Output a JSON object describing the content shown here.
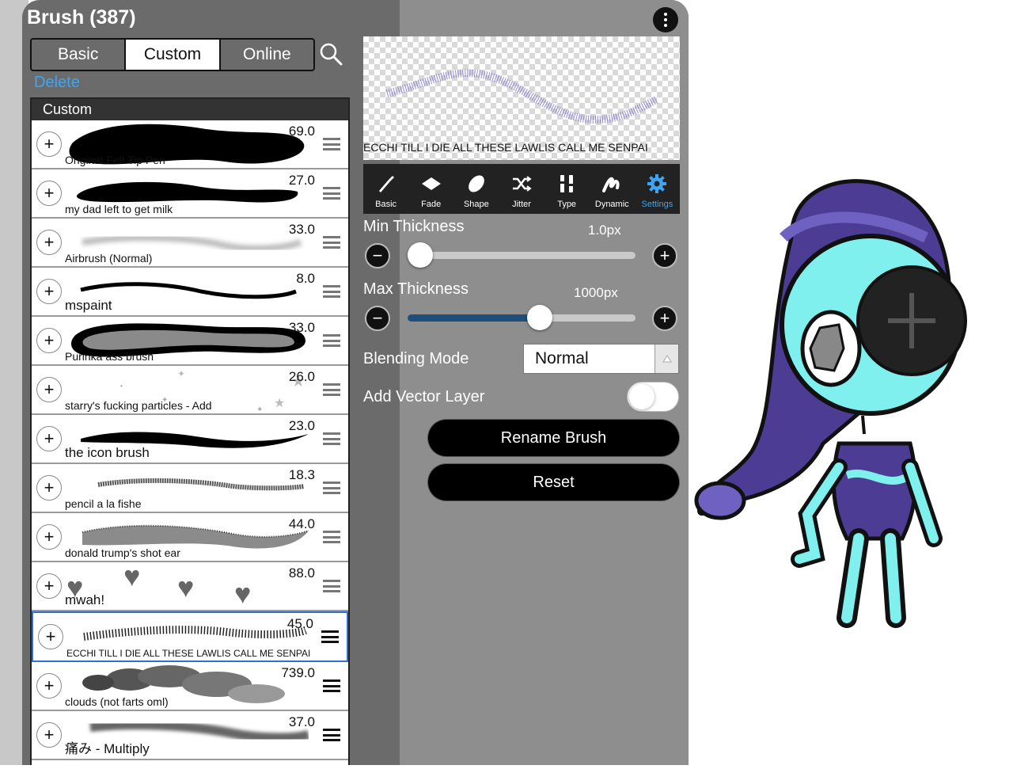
{
  "panel": {
    "title": "Brush (387)",
    "tabs": [
      {
        "label": "Basic"
      },
      {
        "label": "Custom"
      },
      {
        "label": "Online"
      }
    ],
    "delete_label": "Delete",
    "list_header": "Custom"
  },
  "brushes": [
    {
      "name": "Original Felt Tip Pen",
      "value": "69.0"
    },
    {
      "name": "my dad left to get milk",
      "value": "27.0"
    },
    {
      "name": "Airbrush (Normal)",
      "value": "33.0"
    },
    {
      "name": "mspaint",
      "value": "8.0"
    },
    {
      "name": "Puririka ass brush",
      "value": "33.0"
    },
    {
      "name": "starry's fucking particles - Add",
      "value": "26.0"
    },
    {
      "name": "the icon brush",
      "value": "23.0"
    },
    {
      "name": "pencil a la fishe",
      "value": "18.3"
    },
    {
      "name": "donald trump's shot ear",
      "value": "44.0"
    },
    {
      "name": "mwah!",
      "value": "88.0"
    },
    {
      "name": "ECCHI TILL I DIE ALL THESE LAWLIS CALL ME SENPAI",
      "value": "45.0"
    },
    {
      "name": "clouds (not farts oml)",
      "value": "739.0"
    },
    {
      "name": "痛み - Multiply",
      "value": "37.0"
    }
  ],
  "selected_brush_index": 10,
  "preview": {
    "caption": "ECCHI TILL I DIE ALL THESE LAWLIS CALL ME SENPAI"
  },
  "toolbar": [
    {
      "label": "Basic",
      "icon": "brush-icon"
    },
    {
      "label": "Fade",
      "icon": "fade-icon"
    },
    {
      "label": "Shape",
      "icon": "shape-icon"
    },
    {
      "label": "Jitter",
      "icon": "shuffle-icon"
    },
    {
      "label": "Type",
      "icon": "type-icon"
    },
    {
      "label": "Dynamic",
      "icon": "dynamic-icon"
    },
    {
      "label": "Settings",
      "icon": "gear-icon"
    }
  ],
  "settings": {
    "min_thickness_label": "Min Thickness",
    "min_thickness_value": "1.0px",
    "min_thickness_level": 0.0,
    "max_thickness_label": "Max Thickness",
    "max_thickness_value": "1000px",
    "max_thickness_level": 0.58,
    "blending_label": "Blending Mode",
    "blending_value": "Normal",
    "vector_label": "Add Vector Layer",
    "vector_on": false,
    "rename_label": "Rename Brush",
    "reset_label": "Reset"
  },
  "colors": {
    "accent": "#3ea5f2",
    "panel_left": "#6b6b6b",
    "panel_right": "#8e8e8e",
    "slider_fill": "#1e4e79",
    "character_skin": "#7ff0ee",
    "character_hair": "#4c3c93"
  }
}
